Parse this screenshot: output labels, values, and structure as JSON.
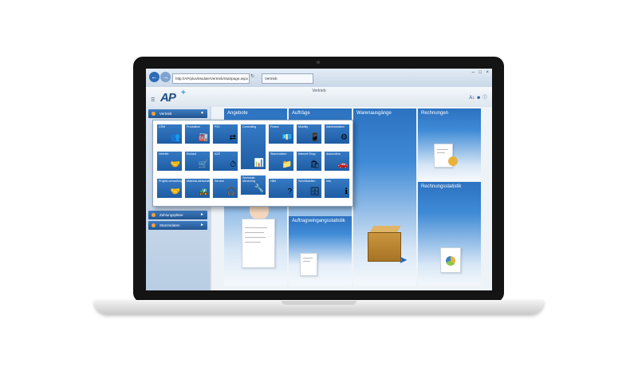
{
  "browser": {
    "url": "http://AP/plus/Module/Vertrieb/Startpage.aspx",
    "tab_label": "Vertrieb",
    "back_icon": "back-arrow-icon",
    "forward_icon": "forward-arrow-icon"
  },
  "app": {
    "title": "Vertrieb",
    "logo_main": "AP",
    "logo_sub": "PLUS"
  },
  "sidebar": {
    "active_item": "Vertrieb",
    "items": [
      {
        "label": "Zahlungspläne"
      },
      {
        "label": "Stammdaten"
      }
    ]
  },
  "tiles": {
    "angebote": "Angebote",
    "auftraege": "Aufträge",
    "warenausgaenge": "Warenausgänge",
    "rechnungen": "Rechnungen",
    "rechnungsstatistik": "Rechnungsstatistik",
    "auftragseingangsstatistik": "Auftragseingangsstatistik"
  },
  "menu": {
    "items": [
      {
        "label": "CRM",
        "icon": "people-icon"
      },
      {
        "label": "Produktion",
        "icon": "factory-icon"
      },
      {
        "label": "P2C",
        "icon": "connect-icon"
      },
      {
        "label": "Controlling",
        "icon": "chart-icon"
      },
      {
        "label": "Finanz",
        "icon": "money-icon"
      },
      {
        "label": "Mobility",
        "icon": "phone-icon"
      },
      {
        "label": "Administration",
        "icon": "gears-icon"
      },
      {
        "label": "Vertrieb",
        "icon": "handshake-icon"
      },
      {
        "label": "Einkauf",
        "icon": "cart-icon"
      },
      {
        "label": "AZE",
        "icon": "clock-icon"
      },
      {
        "label": "Stammdaten",
        "icon": "folders-icon"
      },
      {
        "label": "Internet Shop",
        "icon": "shop-icon"
      },
      {
        "label": "Automotive",
        "icon": "car-icon"
      },
      {
        "label": "Projekt-verwaltung",
        "icon": "handshake-icon"
      },
      {
        "label": "Material-wirtschaft",
        "icon": "forklift-icon"
      },
      {
        "label": "Service",
        "icon": "headset-icon"
      },
      {
        "label": "Werkstatt-steuerung",
        "icon": "workshop-icon"
      },
      {
        "label": "Schnittstellen",
        "icon": "database-icon"
      },
      {
        "label": "Hilfe",
        "icon": "help-icon"
      },
      {
        "label": "Info",
        "icon": "info-icon"
      }
    ]
  },
  "colors": {
    "tile_blue": "#2c72c0",
    "menu_blue": "#1e5da4",
    "accent_orange": "#f2a23a"
  }
}
